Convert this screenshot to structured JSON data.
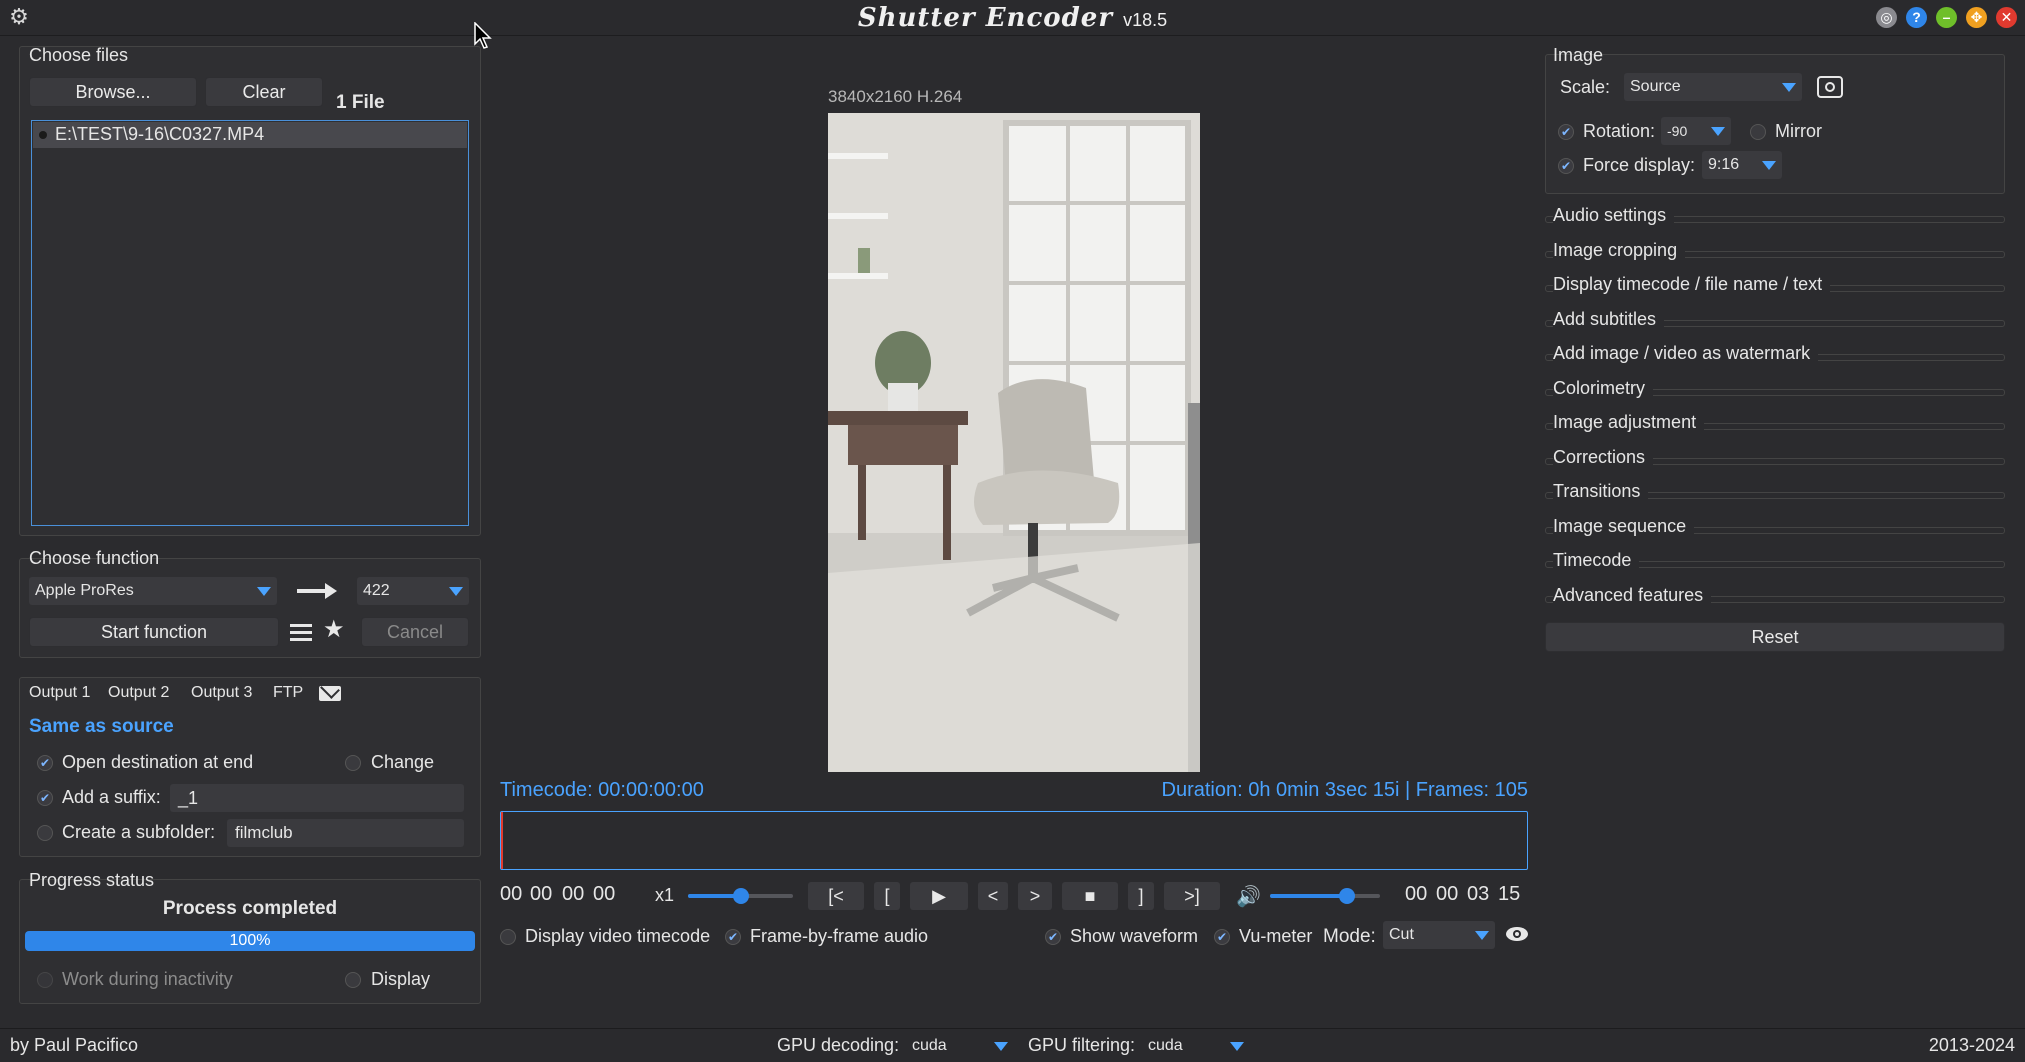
{
  "app": {
    "title": "Shutter Encoder",
    "version": "v18.5"
  },
  "choose_files": {
    "title": "Choose files",
    "browse_label": "Browse...",
    "clear_label": "Clear",
    "count": "1 File",
    "files": [
      "E:\\TEST\\9-16\\C0327.MP4"
    ]
  },
  "choose_function": {
    "title": "Choose function",
    "function": "Apple ProRes",
    "codec": "422",
    "start_label": "Start function",
    "cancel_label": "Cancel"
  },
  "output": {
    "tabs": [
      "Output 1",
      "Output 2",
      "Output 3",
      "FTP"
    ],
    "destination": "Same as source",
    "open_dest_label": "Open destination at end",
    "change_label": "Change",
    "suffix_label": "Add a suffix:",
    "suffix_value": "_1",
    "subfolder_label": "Create a subfolder:",
    "subfolder_placeholder": "filmclub"
  },
  "progress": {
    "title": "Progress status",
    "status": "Process completed",
    "percent_label": "100%",
    "percent": 1.0,
    "inactivity_label": "Work during inactivity",
    "display_label": "Display"
  },
  "preview": {
    "info": "3840x2160 H.264",
    "timecode_label": "Timecode: 00:00:00:00",
    "duration_label": "Duration: 0h 0min 3sec 15i | Frames: 105"
  },
  "player": {
    "tc_in": [
      "00",
      "00",
      "00",
      "00"
    ],
    "speed": "x1",
    "speed_level": 0.5,
    "buttons": [
      "[<",
      "[",
      "▶",
      "<",
      ">",
      "■",
      "]",
      ">]"
    ],
    "volume_level": 0.7,
    "tc_out": [
      "00",
      "00",
      "03",
      "15"
    ],
    "display_tc_label": "Display video timecode",
    "frame_audio_label": "Frame-by-frame audio",
    "waveform_label": "Show waveform",
    "vumeter_label": "Vu-meter",
    "mode_label": "Mode:",
    "mode_value": "Cut"
  },
  "image": {
    "title": "Image",
    "scale_label": "Scale:",
    "scale_value": "Source",
    "rotation_label": "Rotation:",
    "rotation_value": "-90",
    "mirror_label": "Mirror",
    "force_display_label": "Force display:",
    "force_display_value": "9:16"
  },
  "settings": [
    "Audio settings",
    "Image cropping",
    "Display timecode / file name / text",
    "Add subtitles",
    "Add image / video as watermark",
    "Colorimetry",
    "Image adjustment",
    "Corrections",
    "Transitions",
    "Image sequence",
    "Timecode",
    "Advanced features"
  ],
  "reset_label": "Reset",
  "status": {
    "author": "by Paul Pacifico",
    "gpu_decoding_label": "GPU decoding:",
    "gpu_decoding_value": "cuda",
    "gpu_filtering_label": "GPU filtering:",
    "gpu_filtering_value": "cuda",
    "years": "2013-2024"
  },
  "colors": {
    "accent": "#4aa3ff",
    "progress": "#2f86e9",
    "background": "#2b2b2e"
  }
}
